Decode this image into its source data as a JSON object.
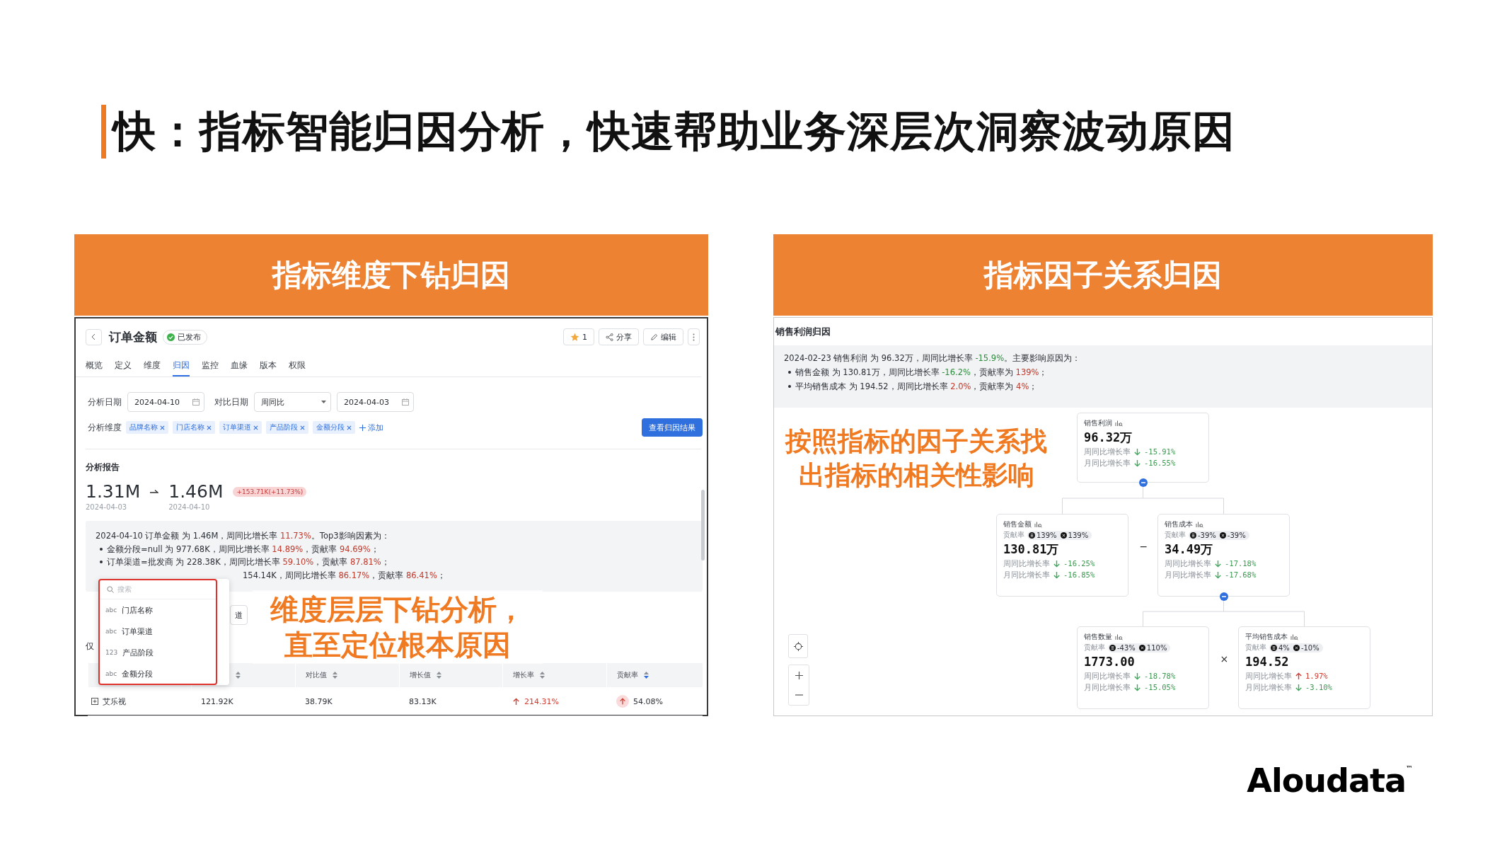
{
  "slide": {
    "title": "快：指标智能归因分析，快速帮助业务深层次洞察波动原因",
    "logo": "Aloudata",
    "trademark": "™"
  },
  "left_section": {
    "header": "指标维度下钻归因",
    "screen": {
      "title": "订单金额",
      "status": "已发布",
      "toolbar": {
        "star_count": "1",
        "share": "分享",
        "edit": "编辑"
      },
      "tabs": [
        {
          "label": "概览",
          "selected": false
        },
        {
          "label": "定义",
          "selected": false
        },
        {
          "label": "维度",
          "selected": false
        },
        {
          "label": "归因",
          "selected": true
        },
        {
          "label": "监控",
          "selected": false
        },
        {
          "label": "血缘",
          "selected": false
        },
        {
          "label": "版本",
          "selected": false
        },
        {
          "label": "权限",
          "selected": false
        }
      ],
      "filters": {
        "date_label": "分析日期",
        "date": "2024-04-10",
        "compare_label": "对比日期",
        "compare_mode": "周同比",
        "compare_date": "2024-04-03"
      },
      "dimensions": {
        "label": "分析维度",
        "tags": [
          "品牌名称",
          "门店名称",
          "订单渠道",
          "产品阶段",
          "金额分段"
        ],
        "add": "添加",
        "run_button": "查看归因结果"
      },
      "report": {
        "title": "分析报告",
        "base_value": "1.31M",
        "base_date": "2024-04-03",
        "current_value": "1.46M",
        "current_date": "2024-04-10",
        "change": "+153.71K(+11.73%)"
      },
      "summary": [
        {
          "kind": "headline",
          "segments": [
            {
              "text": "2024-04-10 订单金额 为 1.46M，周同比增长率 "
            },
            {
              "text": "11.73%",
              "color": "#c0392b"
            },
            {
              "text": "。Top3影响因素为："
            }
          ]
        },
        {
          "kind": "bullet",
          "segments": [
            {
              "text": "金额分段=null 为 977.68K，周同比增长率 "
            },
            {
              "text": "14.89%",
              "color": "#c0392b"
            },
            {
              "text": "，贡献率 "
            },
            {
              "text": "94.69%",
              "color": "#c0392b"
            },
            {
              "text": "；"
            }
          ]
        },
        {
          "kind": "bullet",
          "segments": [
            {
              "text": "订单渠道=批发商 为 228.38K，周同比增长率 "
            },
            {
              "text": "59.10%",
              "color": "#c0392b"
            },
            {
              "text": "，贡献率 "
            },
            {
              "text": "87.81%",
              "color": "#c0392b"
            },
            {
              "text": "；"
            }
          ]
        },
        {
          "kind": "cut",
          "segments": [
            {
              "text": "154.14K，周同比增长率 "
            },
            {
              "text": "86.17%",
              "color": "#c0392b"
            },
            {
              "text": "，贡献率 "
            },
            {
              "text": "86.41%",
              "color": "#c0392b"
            },
            {
              "text": "；"
            }
          ]
        }
      ],
      "dimension_buttons": [
        "道"
      ],
      "note": "仅",
      "table": {
        "columns": [
          {
            "kind": "hidden"
          },
          {
            "kind": "sort_only",
            "sorted": false
          },
          {
            "kind": "label",
            "label": "对比值",
            "sorted": false
          },
          {
            "kind": "label",
            "label": "增长值",
            "sorted": false
          },
          {
            "kind": "label",
            "label": "增长率",
            "sorted": false
          },
          {
            "kind": "label",
            "label": "贡献率",
            "sorted": true
          }
        ],
        "rows": [
          {
            "cells": [
              {
                "kind": "expandable",
                "text": "艾乐视"
              },
              {
                "kind": "plain",
                "text": "121.92K"
              },
              {
                "kind": "plain",
                "text": "38.79K"
              },
              {
                "kind": "plain",
                "text": "83.13K"
              },
              {
                "kind": "trend_up",
                "text": "214.31%"
              },
              {
                "kind": "badge_up",
                "text": "54.08%"
              }
            ]
          }
        ]
      },
      "dropdown": {
        "placeholder": "搜索",
        "items": [
          {
            "type": "abc",
            "label": "门店名称"
          },
          {
            "type": "abc",
            "label": "订单渠道"
          },
          {
            "type": "123",
            "label": "产品阶段"
          },
          {
            "type": "abc",
            "label": "金额分段"
          }
        ]
      }
    },
    "caption": [
      "维度层层下钻分析，",
      "直至定位根本原因"
    ]
  },
  "right_section": {
    "header": "指标因子关系归因",
    "screen": {
      "title": "销售利润归因",
      "summary": [
        {
          "kind": "headline",
          "segments": [
            {
              "text": "2024-02-23 销售利润 为 96.32万，周同比增长率 "
            },
            {
              "text": "-15.9%",
              "color": "#2e8b3e"
            },
            {
              "text": "。主要影响原因为："
            }
          ]
        },
        {
          "kind": "bullet",
          "segments": [
            {
              "text": "销售金额 为 130.81万，周同比增长率 "
            },
            {
              "text": "-16.2%",
              "color": "#2e8b3e"
            },
            {
              "text": "，贡献率为 "
            },
            {
              "text": "139%",
              "color": "#c0392b"
            },
            {
              "text": "；"
            }
          ]
        },
        {
          "kind": "bullet",
          "segments": [
            {
              "text": "平均销售成本 为 194.52，周同比增长率 "
            },
            {
              "text": "2.0%",
              "color": "#c0392b"
            },
            {
              "text": "，贡献率为 "
            },
            {
              "text": "4%",
              "color": "#c0392b"
            },
            {
              "text": "；"
            }
          ]
        }
      ],
      "tree": {
        "name": "销售利润",
        "value": "96.32万",
        "rates": [
          {
            "label": "周同比增长率",
            "value": "-15.91%",
            "kind": "down"
          },
          {
            "label": "月同比增长率",
            "value": "-16.55%",
            "kind": "down"
          }
        ],
        "expanded": true,
        "operator": "−",
        "children": [
          {
            "name": "销售金额",
            "contribution_label": "贡献率",
            "contribution": [
              "139%",
              "139%"
            ],
            "value": "130.81万",
            "rates": [
              {
                "label": "周同比增长率",
                "value": "-16.25%",
                "kind": "down"
              },
              {
                "label": "月同比增长率",
                "value": "-16.85%",
                "kind": "down"
              }
            ]
          },
          {
            "name": "销售成本",
            "contribution_label": "贡献率",
            "contribution": [
              "-39%",
              "-39%"
            ],
            "value": "34.49万",
            "rates": [
              {
                "label": "周同比增长率",
                "value": "-17.18%",
                "kind": "down"
              },
              {
                "label": "月同比增长率",
                "value": "-17.68%",
                "kind": "down"
              }
            ],
            "expanded": true,
            "operator": "×",
            "children": [
              {
                "name": "销售数量",
                "contribution_label": "贡献率",
                "contribution": [
                  "-43%",
                  "110%"
                ],
                "value": "1773.00",
                "rates": [
                  {
                    "label": "周同比增长率",
                    "value": "-18.78%",
                    "kind": "down"
                  },
                  {
                    "label": "月同比增长率",
                    "value": "-15.05%",
                    "kind": "down"
                  }
                ]
              },
              {
                "name": "平均销售成本",
                "contribution_label": "贡献率",
                "contribution": [
                  "4%",
                  "-10%"
                ],
                "value": "194.52",
                "rates": [
                  {
                    "label": "周同比增长率",
                    "value": "1.97%",
                    "kind": "up"
                  },
                  {
                    "label": "月同比增长率",
                    "value": "-3.10%",
                    "kind": "down"
                  }
                ]
              }
            ]
          }
        ]
      }
    },
    "caption": [
      "按照指标的因子关系找",
      "出指标的相关性影响"
    ]
  }
}
